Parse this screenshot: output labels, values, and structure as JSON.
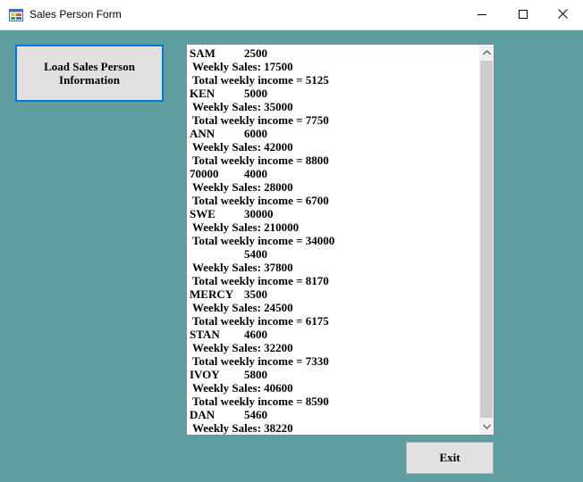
{
  "window": {
    "title": "Sales Person Form",
    "controls": {
      "minimize": "minimize-icon",
      "maximize": "maximize-icon",
      "close": "close-icon"
    }
  },
  "load_button": {
    "label": "Load Sales Person Information"
  },
  "exit_button": {
    "label": "Exit"
  },
  "colors": {
    "form_background": "#5f9ea0",
    "titlebar": "#ffffff",
    "button_face": "#e1e1e1",
    "focus_border": "#0078d7"
  },
  "listbox": {
    "lines": [
      {
        "name": "SAM",
        "value": "2500"
      },
      {
        "text": "Weekly Sales: 17500"
      },
      {
        "text": "Total weekly income = 5125"
      },
      {
        "name": "KEN",
        "value": "5000"
      },
      {
        "text": "Weekly Sales: 35000"
      },
      {
        "text": "Total weekly income = 7750"
      },
      {
        "name": "ANN",
        "value": "6000"
      },
      {
        "text": "Weekly Sales: 42000"
      },
      {
        "text": "Total weekly income = 8800"
      },
      {
        "name": "70000",
        "value": "4000"
      },
      {
        "text": "Weekly Sales: 28000"
      },
      {
        "text": "Total weekly income = 6700"
      },
      {
        "name": "SWE",
        "value": "30000"
      },
      {
        "text": "Weekly Sales: 210000"
      },
      {
        "text": "Total weekly income = 34000"
      },
      {
        "name": "",
        "value": "5400"
      },
      {
        "text": "Weekly Sales: 37800"
      },
      {
        "text": "Total weekly income = 8170"
      },
      {
        "name": "MERCY",
        "value": "3500"
      },
      {
        "text": "Weekly Sales: 24500"
      },
      {
        "text": "Total weekly income = 6175"
      },
      {
        "name": "STAN",
        "value": "4600"
      },
      {
        "text": "Weekly Sales: 32200"
      },
      {
        "text": "Total weekly income = 7330"
      },
      {
        "name": "IVOY",
        "value": "5800"
      },
      {
        "text": "Weekly Sales: 40600"
      },
      {
        "text": "Total weekly income = 8590"
      },
      {
        "name": "DAN",
        "value": "5460"
      },
      {
        "text": "Weekly Sales: 38220"
      }
    ]
  }
}
